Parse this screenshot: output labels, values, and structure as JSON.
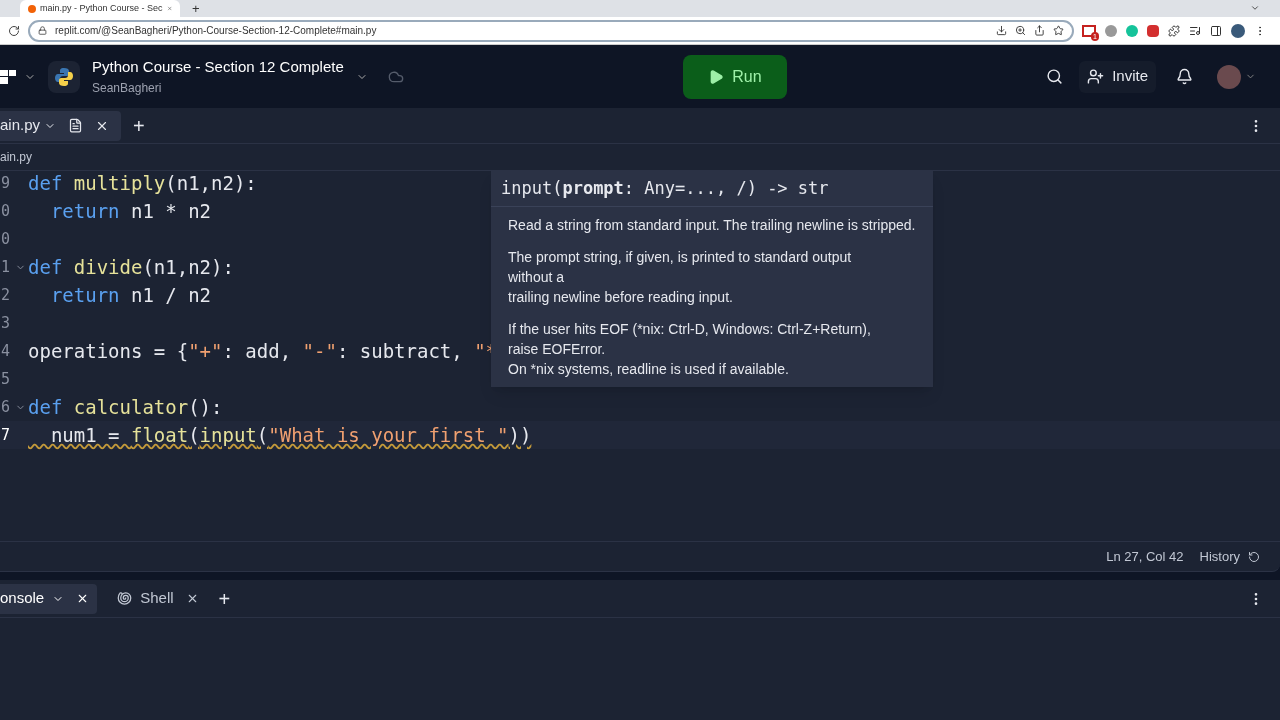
{
  "browser": {
    "tab_title": "main.py - Python Course - Sec",
    "new_tab": "+",
    "url": "replit.com/@SeanBagheri/Python-Course-Section-12-Complete#main.py",
    "mail_badge": "1"
  },
  "header": {
    "title": "Python Course - Section 12 Complete",
    "owner": "SeanBagheri",
    "run_label": "Run",
    "invite_label": "Invite"
  },
  "editor": {
    "tab": "ain.py",
    "new_tab": "+",
    "breadcrumb": "ain.py",
    "lines": [
      {
        "number": "9",
        "fold": false,
        "current": false,
        "tokens": [
          {
            "kind": "kw",
            "text": "def "
          },
          {
            "kind": "fn",
            "text": "multiply"
          },
          {
            "kind": "plain",
            "text": "(n1,n2):"
          }
        ]
      },
      {
        "number": "0",
        "fold": false,
        "current": false,
        "tokens": [
          {
            "kind": "kw",
            "text": "  return"
          },
          {
            "kind": "plain",
            "text": " n1 * n2"
          }
        ]
      },
      {
        "number": "0",
        "fold": false,
        "current": false
      },
      {
        "number": "1",
        "fold": true,
        "current": false,
        "tokens": [
          {
            "kind": "kw",
            "text": "def "
          },
          {
            "kind": "fn",
            "text": "divide"
          },
          {
            "kind": "plain",
            "text": "(n1,n2):"
          }
        ]
      },
      {
        "number": "2",
        "fold": false,
        "current": false,
        "tokens": [
          {
            "kind": "kw",
            "text": "  return"
          },
          {
            "kind": "plain",
            "text": " n1 / n2"
          }
        ]
      },
      {
        "number": "3",
        "fold": false,
        "current": false
      },
      {
        "number": "4",
        "fold": false,
        "current": false,
        "tokens": [
          {
            "kind": "plain",
            "text": "operations = {"
          },
          {
            "kind": "str",
            "text": "\"+\""
          },
          {
            "kind": "plain",
            "text": ": add, "
          },
          {
            "kind": "str",
            "text": "\"-\""
          },
          {
            "kind": "plain",
            "text": ": subtract, "
          },
          {
            "kind": "str",
            "text": "\"*"
          }
        ]
      },
      {
        "number": "5",
        "fold": false,
        "current": false
      },
      {
        "number": "6",
        "fold": true,
        "current": false,
        "tokens": [
          {
            "kind": "kw",
            "text": "def "
          },
          {
            "kind": "fn",
            "text": "calculator"
          },
          {
            "kind": "plain",
            "text": "():"
          }
        ]
      },
      {
        "number": "7",
        "fold": false,
        "current": true,
        "tokens": [
          {
            "kind": "plain",
            "text": "  num1 = "
          },
          {
            "kind": "fn",
            "text": "float"
          },
          {
            "kind": "plain",
            "text": "("
          },
          {
            "kind": "fn",
            "text": "input"
          },
          {
            "kind": "plain",
            "text": "("
          },
          {
            "kind": "str",
            "text": "\"What is your first \""
          },
          {
            "kind": "plain",
            "text": "))"
          }
        ]
      }
    ],
    "tooltip": {
      "signature": "input(**prompt**: Any=..., /) -> str",
      "paragraphs": [
        [
          "Read a string from standard input.  The trailing newline is stripped."
        ],
        [
          "The prompt string, if given, is printed to standard output",
          "without a",
          "trailing newline before reading input."
        ],
        [
          "If the user hits EOF (*nix: Ctrl-D, Windows: Ctrl-Z+Return),",
          "raise EOFError.",
          "On *nix systems, readline is used if available."
        ]
      ]
    },
    "status": {
      "position": "Ln 27, Col 42",
      "history": "History"
    }
  },
  "bottom": {
    "tabs": [
      {
        "label": "onsole",
        "selected": true,
        "kind": "console"
      },
      {
        "label": "Shell",
        "selected": false,
        "kind": "shell"
      }
    ],
    "new_tab": "+"
  }
}
